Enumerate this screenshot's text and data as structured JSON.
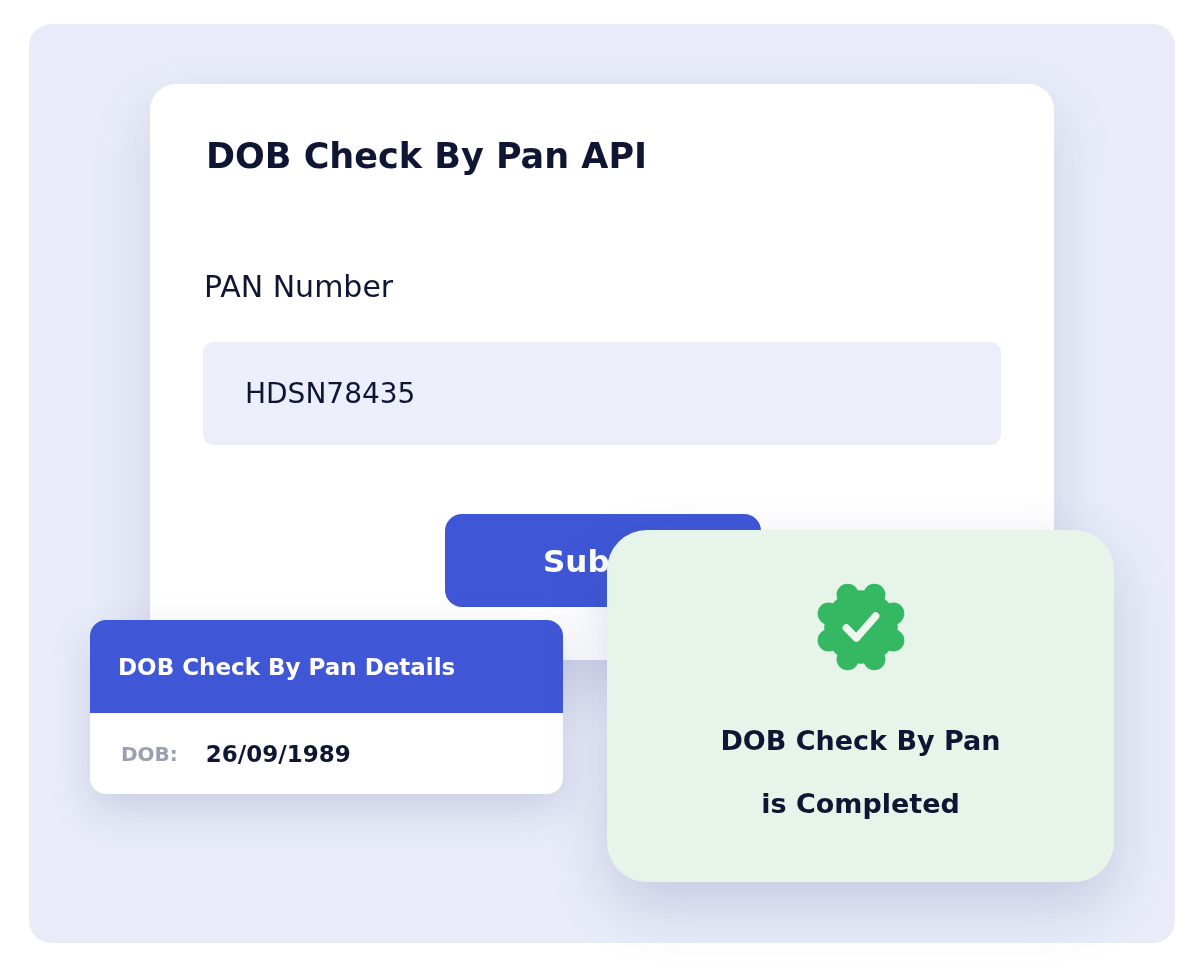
{
  "form_card": {
    "title": "DOB Check By Pan API",
    "field": {
      "label": "PAN Number",
      "value": "HDSN78435"
    },
    "submit_button": {
      "label": "Sub"
    }
  },
  "details_card": {
    "title": "DOB Check By Pan Details",
    "rows": [
      {
        "label": "DOB:",
        "value": "26/09/1989"
      }
    ]
  },
  "success_card": {
    "message_lines": [
      "DOB Check By Pan",
      "is Completed"
    ]
  }
}
